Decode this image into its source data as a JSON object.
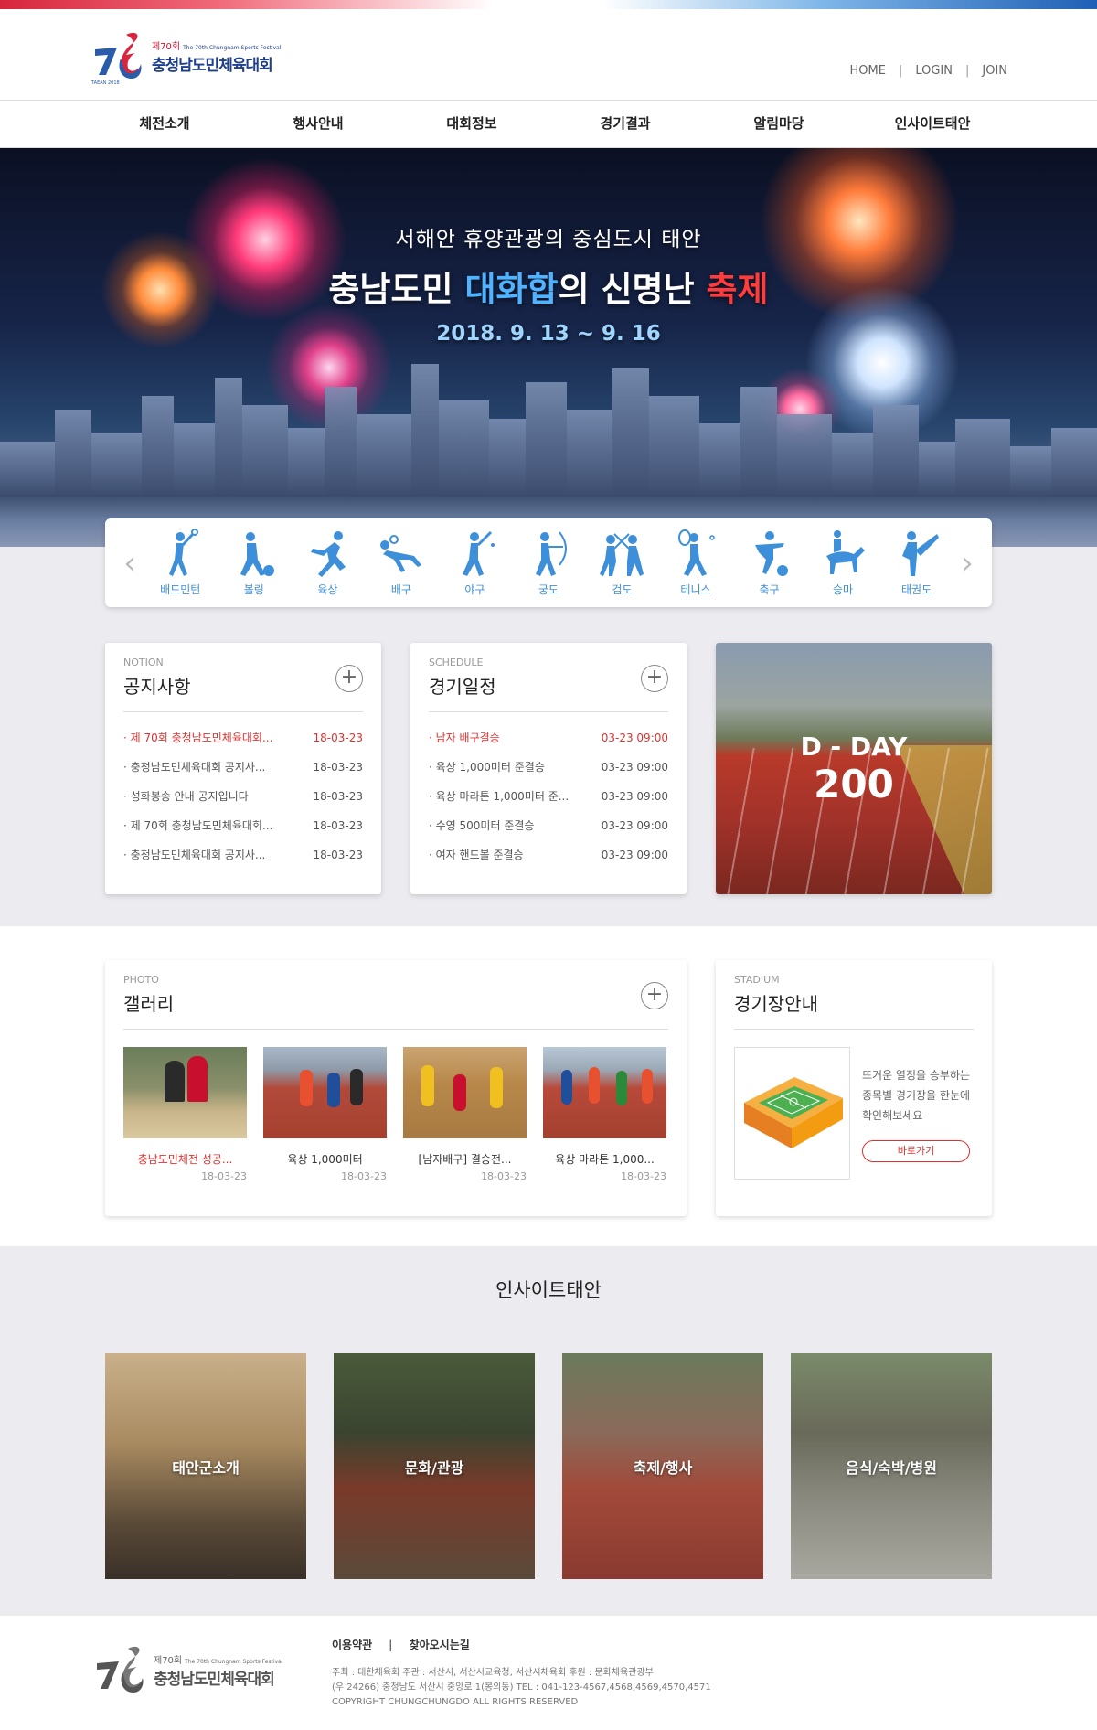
{
  "header": {
    "logo_edition": "제70회",
    "logo_en": "The 70th Chungnam Sports Festival",
    "logo_title": "충청남도민체육대회",
    "logo_mark_year": "TAEAN 2018",
    "util_links": [
      "HOME",
      "LOGIN",
      "JOIN"
    ],
    "util_sep": "|"
  },
  "nav": {
    "items": [
      "체전소개",
      "행사안내",
      "대회정보",
      "경기결과",
      "알림마당",
      "인사이트태안"
    ]
  },
  "hero": {
    "subtitle": "서해안 휴양관광의 중심도시 태안",
    "title_a": "충남도민 ",
    "title_b": "대화합",
    "title_c": "의 신명난 ",
    "title_d": "축제",
    "date": "2018. 9. 13 ~ 9. 16"
  },
  "sports": {
    "prev": "‹",
    "next": "›",
    "items": [
      "배드민턴",
      "볼링",
      "육상",
      "배구",
      "야구",
      "궁도",
      "검도",
      "테니스",
      "축구",
      "승마",
      "태권도"
    ]
  },
  "notice": {
    "caption": "NOTION",
    "title": "공지사항",
    "more": "+",
    "rows": [
      {
        "text": "· 제 70회 충청남도민체육대회...",
        "date": "18-03-23"
      },
      {
        "text": "· 충청남도민체육대회 공지사...",
        "date": "18-03-23"
      },
      {
        "text": "· 성화봉송 안내 공지입니다",
        "date": "18-03-23"
      },
      {
        "text": "· 제 70회 충청남도민체육대회...",
        "date": "18-03-23"
      },
      {
        "text": "· 충청남도민체육대회 공지사...",
        "date": "18-03-23"
      }
    ]
  },
  "schedule": {
    "caption": "SCHEDULE",
    "title": "경기일정",
    "more": "+",
    "rows": [
      {
        "text": "· 남자 배구결승",
        "date": "03-23 09:00"
      },
      {
        "text": "· 육상 1,000미터 준결승",
        "date": "03-23 09:00"
      },
      {
        "text": "· 육상 마라톤 1,000미터 준...",
        "date": "03-23 09:00"
      },
      {
        "text": "· 수영 500미터 준결승",
        "date": "03-23 09:00"
      },
      {
        "text": "· 여자 핸드볼 준결승",
        "date": "03-23 09:00"
      }
    ]
  },
  "dday": {
    "label": "D - DAY",
    "value": "200"
  },
  "gallery": {
    "caption": "PHOTO",
    "title": "갤러리",
    "more": "+",
    "items": [
      {
        "caption": "충남도민체전 성공...",
        "date": "18-03-23"
      },
      {
        "caption": "육상 1,000미터",
        "date": "18-03-23"
      },
      {
        "caption": "[남자배구] 결승전...",
        "date": "18-03-23"
      },
      {
        "caption": "육상 마라톤 1,000...",
        "date": "18-03-23"
      }
    ]
  },
  "stadium": {
    "caption": "STADIUM",
    "title": "경기장안내",
    "line1": "뜨거운 열정을 승부하는",
    "line2": "종목별 경기장을 한눈에",
    "line3": "확인해보세요",
    "button": "바로가기"
  },
  "insight": {
    "title": "인사이트태안",
    "items": [
      "태안군소개",
      "문화/관광",
      "축제/행사",
      "음식/숙박/병원"
    ]
  },
  "footer": {
    "link1": "이용약관",
    "sep": "|",
    "link2": "찾아오시는길",
    "info1": "주최 : 대한체육회    주관 : 서산시, 서산시교육청, 서산시체육회     후원 : 문화체육관광부",
    "info2": "(우 24266) 충청남도 서산시 중앙로 1(봉의동)  TEL : 041-123-4567,4568,4569,4570,4571",
    "info3": "COPYRIGHT CHUNGCHUNGDO ALL RIGHTS RESERVED"
  }
}
